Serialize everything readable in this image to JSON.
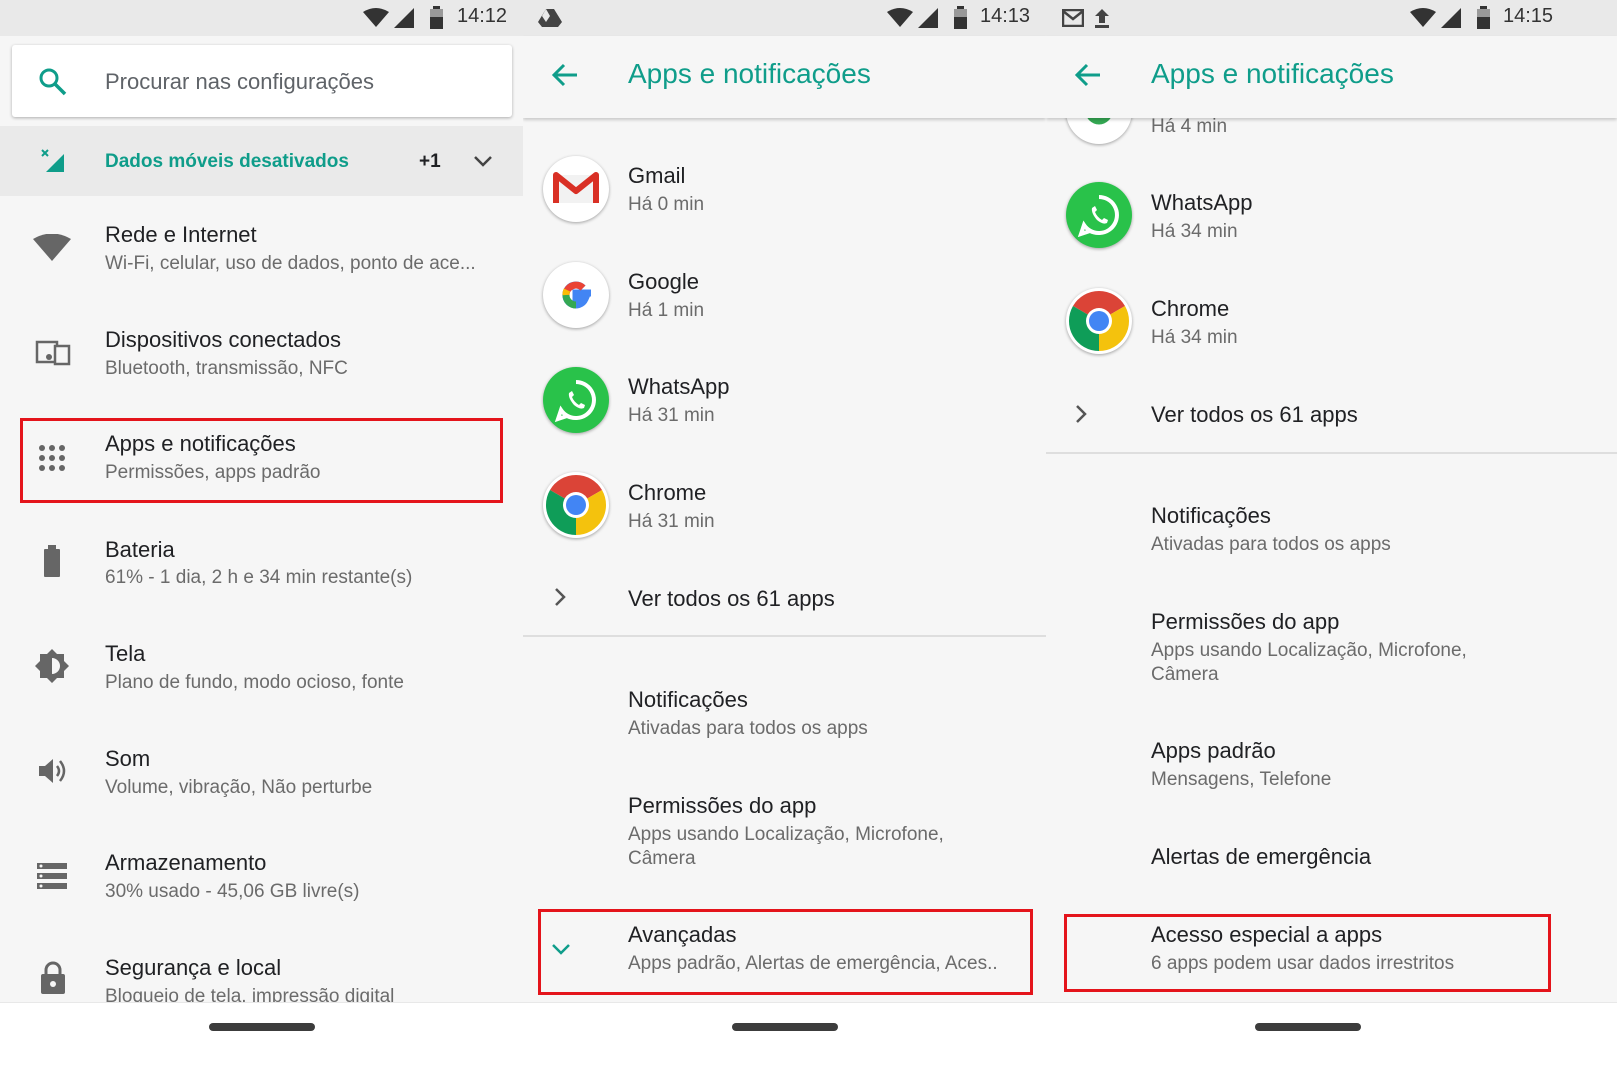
{
  "panel1": {
    "time": "14:12",
    "search_placeholder": "Procurar nas configurações",
    "banner": {
      "text": "Dados móveis desativados",
      "count": "+1"
    },
    "items": [
      {
        "title": "Rede e Internet",
        "subtitle": "Wi-Fi, celular, uso de dados, ponto de ace...",
        "icon": "wifi-icon"
      },
      {
        "title": "Dispositivos conectados",
        "subtitle": "Bluetooth, transmissão, NFC",
        "icon": "devices-icon"
      },
      {
        "title": "Apps e notificações",
        "subtitle": "Permissões, apps padrão",
        "icon": "apps-icon"
      },
      {
        "title": "Bateria",
        "subtitle": "61% - 1 dia, 2 h e 34 min restante(s)",
        "icon": "battery-icon"
      },
      {
        "title": "Tela",
        "subtitle": "Plano de fundo, modo ocioso, fonte",
        "icon": "brightness-icon"
      },
      {
        "title": "Som",
        "subtitle": "Volume, vibração, Não perturbe",
        "icon": "volume-icon"
      },
      {
        "title": "Armazenamento",
        "subtitle": "30% usado - 45,06 GB livre(s)",
        "icon": "storage-icon"
      },
      {
        "title": "Segurança e local",
        "subtitle": "Bloqueio de tela, impressão digital",
        "icon": "lock-icon"
      }
    ]
  },
  "panel2": {
    "time": "14:13",
    "title": "Apps e notificações",
    "apps": [
      {
        "name": "Gmail",
        "time": "Há 0 min"
      },
      {
        "name": "Google",
        "time": "Há 1 min"
      },
      {
        "name": "WhatsApp",
        "time": "Há 31 min"
      },
      {
        "name": "Chrome",
        "time": "Há 31 min"
      }
    ],
    "see_all": "Ver todos os 61 apps",
    "settings": [
      {
        "title": "Notificações",
        "subtitle": "Ativadas para todos os apps"
      },
      {
        "title": "Permissões do app",
        "subtitle": "Apps usando Localização, Microfone,",
        "subtitle2": "Câmera"
      },
      {
        "title": "Avançadas",
        "subtitle": "Apps padrão, Alertas de emergência, Aces.."
      }
    ]
  },
  "panel3": {
    "time": "14:15",
    "title": "Apps e notificações",
    "partial_time": "Há 4 min",
    "apps": [
      {
        "name": "WhatsApp",
        "time": "Há 34 min"
      },
      {
        "name": "Chrome",
        "time": "Há 34 min"
      }
    ],
    "see_all": "Ver todos os 61 apps",
    "settings": [
      {
        "title": "Notificações",
        "subtitle": "Ativadas para todos os apps"
      },
      {
        "title": "Permissões do app",
        "subtitle": "Apps usando Localização, Microfone,",
        "subtitle2": "Câmera"
      },
      {
        "title": "Apps padrão",
        "subtitle": "Mensagens, Telefone"
      },
      {
        "title": "Alertas de emergência"
      },
      {
        "title": "Acesso especial a apps",
        "subtitle": "6 apps podem usar dados irrestritos"
      }
    ]
  },
  "colors": {
    "accent": "#0f9d8a",
    "highlight": "#e4141b"
  }
}
